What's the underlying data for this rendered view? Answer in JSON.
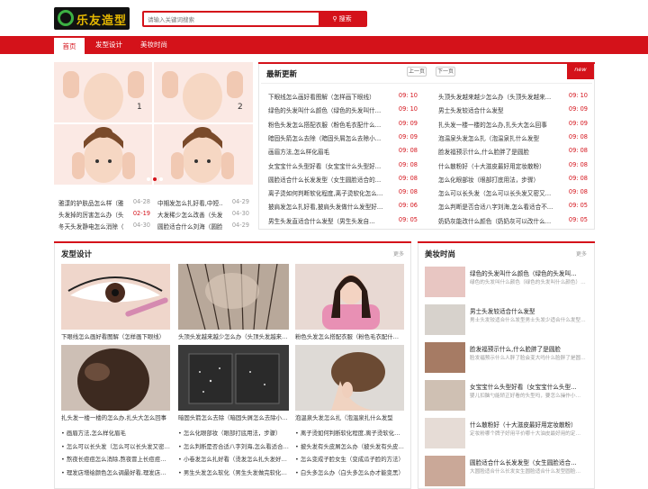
{
  "site": {
    "logo_text": "乐友造型"
  },
  "search": {
    "placeholder": "请输入关键词搜索",
    "button": "搜索"
  },
  "nav": {
    "items": [
      "首页",
      "发型设计",
      "美妆时尚"
    ]
  },
  "left_list": [
    {
      "title": "雅漾的护肤品怎么样（雅…",
      "date": "04-28",
      "red": false
    },
    {
      "title": "中期发怎么扎好看,中短…",
      "date": "04-29",
      "red": false
    },
    {
      "title": "头发掉的厉害怎么办（头…",
      "date": "02-19",
      "red": true
    },
    {
      "title": "大发稀少怎么改善（头发…",
      "date": "04-30",
      "red": false
    },
    {
      "title": "冬天头发静电怎么消除（…",
      "date": "04-30",
      "red": false
    },
    {
      "title": "圆脸适合什么刘海（圆脸…",
      "date": "04-29",
      "red": false
    }
  ],
  "latest": {
    "title": "最新更新",
    "prev": "上一页",
    "next": "下一页",
    "badge": "new",
    "col1": [
      {
        "title": "下眼线怎么画好看图解（怎样画下眼线）",
        "date": "09: 10"
      },
      {
        "title": "绿色的头发叫什么颜色（绿色的头发叫什…",
        "date": "09: 10"
      },
      {
        "title": "粉色头发怎么搭配衣服（粉色毛衣配什么…",
        "date": "09: 09"
      },
      {
        "title": "暗固头箭怎么去除（暗固头屑怎么去除小…",
        "date": "09: 09"
      },
      {
        "title": "画眉方法,怎么样化眉毛",
        "date": "09: 08"
      },
      {
        "title": "女宝宝什么头型好看（女宝宝什么头型好…",
        "date": "09: 08"
      },
      {
        "title": "圆脸适合什么长发发型（女生圆脸适合的…",
        "date": "09: 08"
      },
      {
        "title": "离子烫如何判断软化程度,离子烫软化怎么…",
        "date": "09: 08"
      },
      {
        "title": "披肩发怎么扎好看,披肩头发做什么发型好…",
        "date": "09: 06"
      },
      {
        "title": "男生头发直适合什么发型（男生头发自…",
        "date": "09: 05"
      }
    ],
    "col2": [
      {
        "title": "头顶头发越来越少怎么办（头顶头发越来…",
        "date": "09: 10"
      },
      {
        "title": "男士头发较适合什么发型",
        "date": "09: 09"
      },
      {
        "title": "扎头发一楼一楼的怎么办,扎头大怎么回事",
        "date": "09: 09"
      },
      {
        "title": "泡温泉头发怎么扎（泡温泉扎什么发型",
        "date": "09: 08"
      },
      {
        "title": "脸发福预示什么,什么脸胖了是圆脸",
        "date": "09: 08"
      },
      {
        "title": "什么散粉好（十大滋皮最好用定妆散粉）",
        "date": "09: 08"
      },
      {
        "title": "怎么化眼部妆（眼部打底用法，步骤）",
        "date": "09: 08"
      },
      {
        "title": "怎么可以长头发（怎么可以长头发又密又…",
        "date": "09: 08"
      },
      {
        "title": "怎么判断是否合适八字刘海,怎么看适合不…",
        "date": "09: 05"
      },
      {
        "title": "奶奶灰能改什么颜色（奶奶灰可以改什么…",
        "date": "09: 05"
      }
    ]
  },
  "hair": {
    "title": "发型设计",
    "more": "更多",
    "cards": [
      {
        "caption": "下眼线怎么画好看图解（怎样画下眼线）"
      },
      {
        "caption": "头顶头发越来越少怎么办（头顶头发越来…"
      },
      {
        "caption": "粉色头发怎么搭配衣服（粉色毛衣配什…"
      },
      {
        "caption": "扎头发一楼一楼的怎么办,扎头大怎么回事"
      },
      {
        "caption": "暗固头箭怎么去除（暗固头屑怎么去除小…"
      },
      {
        "caption": "泡温泉头发怎么扎（泡温泉扎什么发型"
      }
    ],
    "list_col1": [
      "画眉方法,怎么样化眉毛",
      "怎么可以长头发（怎么可以长头发又密…",
      "熬夜长痘痘怎么消除,熬夜冒上长痘痘…",
      "理发店增绘颜色怎么调最好看,理发店…"
    ],
    "list_col2": [
      "怎么化眼部妆（眼部打底用法，步骤）",
      "怎么判断是否合适八字刘海,怎么看适合…",
      "小卷发怎么扎好看（烫发怎么扎头发好…",
      "男生头发怎么软化（男生头发做完软化…"
    ],
    "list_col3": [
      "离子烫如何判断软化程度,离子烫软化…",
      "披头发有头皮屑怎么办（披头发有头皮…",
      "怎么变成子脸女生（变成瓜子脸的方法）",
      "白头多怎么办（白头多怎么办才能变黑）"
    ]
  },
  "beauty": {
    "title": "美妆时尚",
    "more": "更多",
    "items": [
      {
        "title": "绿色的头发叫什么颜色（绿色的头发叫…",
        "desc": "绿色的头发叫什么颜色（绿色的头发叫什么颜色）…"
      },
      {
        "title": "男士头发较适合什么发型",
        "desc": "男士头发较适合什么发型男士头发少适合什么发型…"
      },
      {
        "title": "脸发福预示什么,什么脸胖了是圆脸",
        "desc": "脸发福预示什么人胖了脸会变大吗什么脸胖了是圆…"
      },
      {
        "title": "女宝宝什么头型好看（女宝宝什么头型…",
        "desc": "婴儿扣脑勺能矫正好看的头型吗，要怎么操作小…"
      },
      {
        "title": "什么散粉好（十大滋皮最好用定妆散粉）",
        "desc": "定妆粉哪个牌子好用平价哪十大油皮最好用的定…"
      },
      {
        "title": "圆脸适合什么长发发型（女生圆脸适合…",
        "desc": "大圆脸适合什么长发女生圆脸适合什么发型圆脸…"
      }
    ]
  }
}
